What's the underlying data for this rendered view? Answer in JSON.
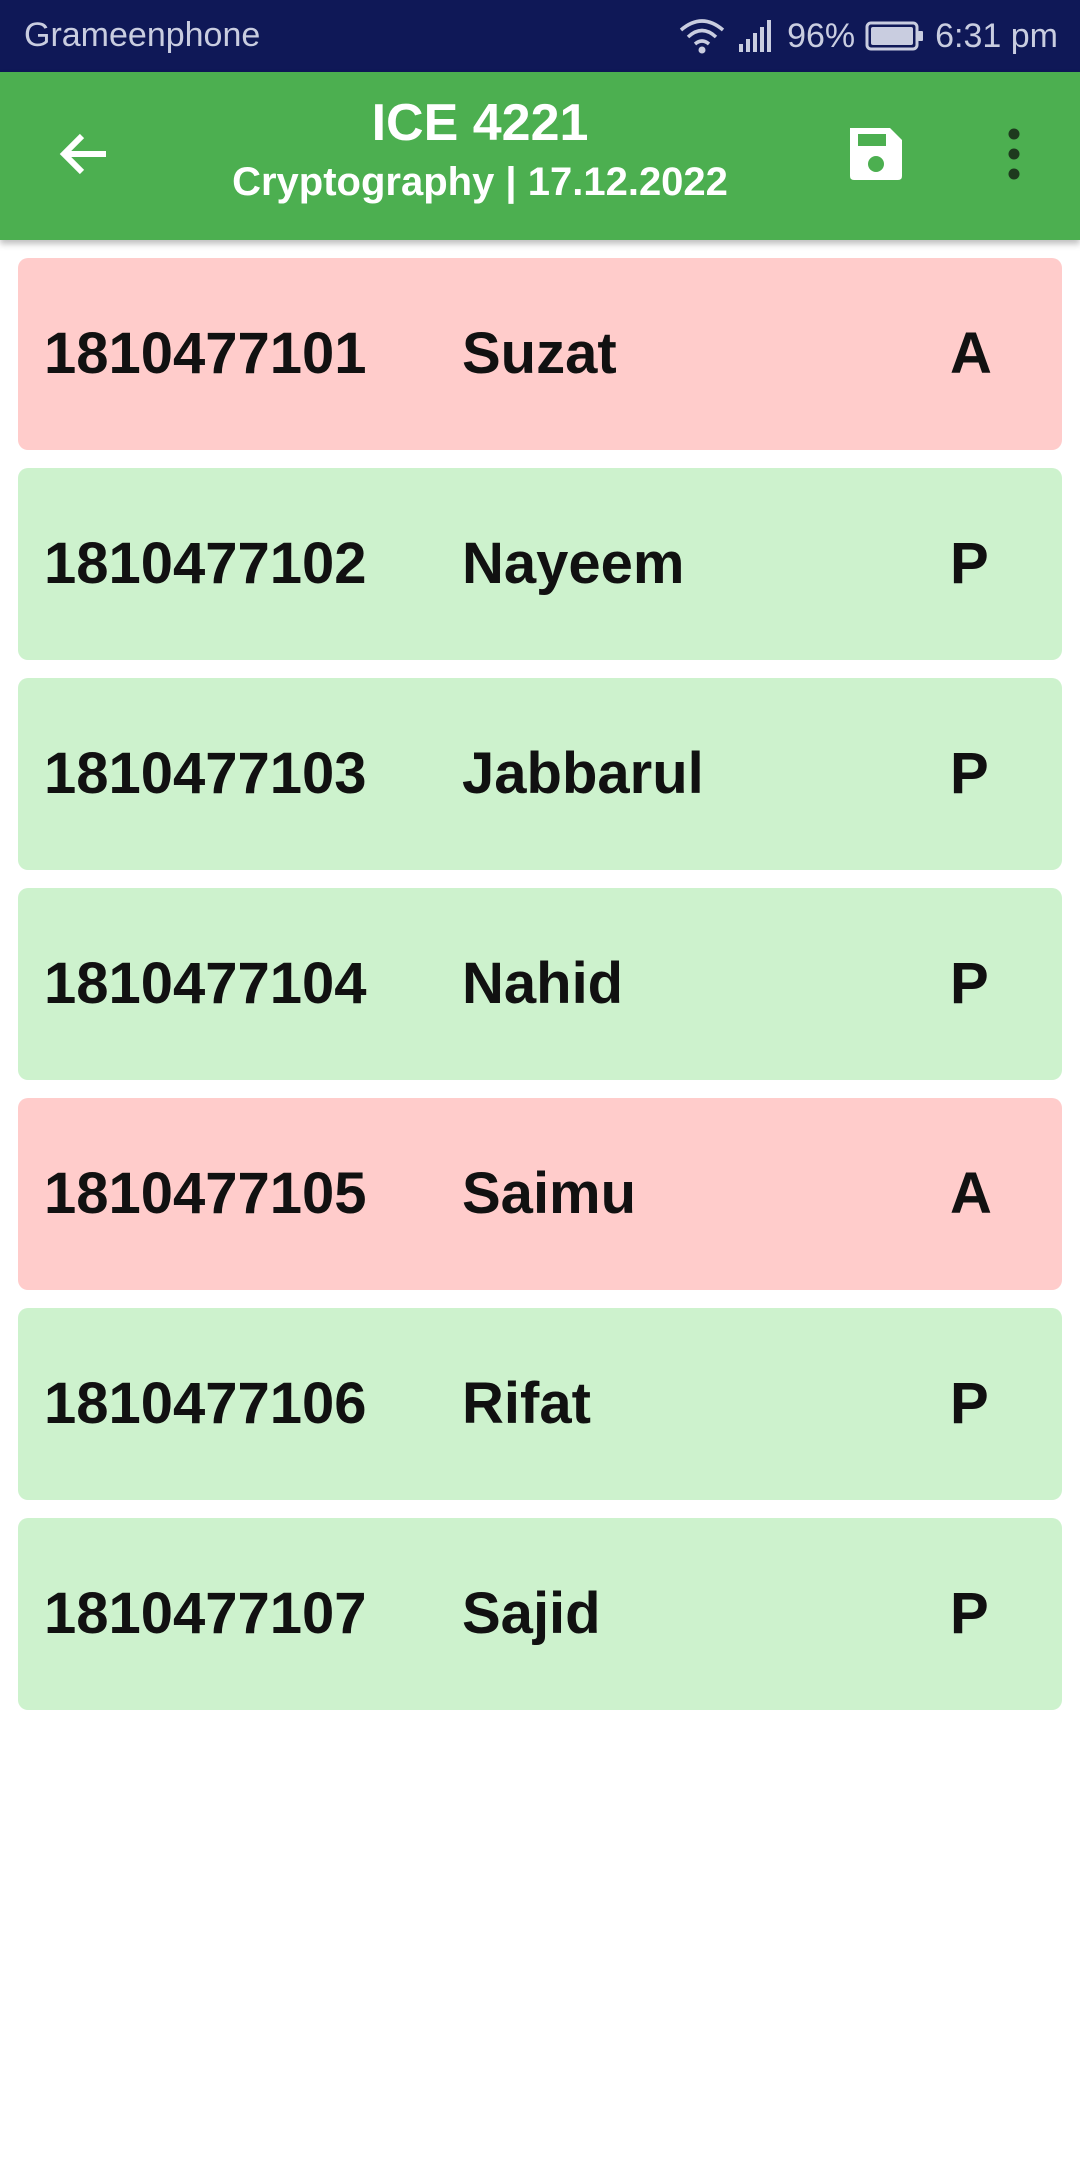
{
  "status_bar": {
    "carrier": "Grameenphone",
    "battery": "96%",
    "time": "6:31 pm",
    "icons": [
      "wifi-icon",
      "signal-icon",
      "battery-icon"
    ]
  },
  "app_bar": {
    "title": "ICE 4221",
    "subtitle": "Cryptography  | 17.12.2022",
    "color": "#4caf50",
    "icons": [
      "back-arrow-icon",
      "save-icon",
      "more-vert-icon"
    ]
  },
  "colors": {
    "absent": "#ffcccb",
    "present": "#cdf2cd",
    "status_bar": "#0f1857"
  },
  "students": [
    {
      "roll": "1810477101",
      "name": "Suzat",
      "mark": "A",
      "status": "absent"
    },
    {
      "roll": "1810477102",
      "name": "Nayeem",
      "mark": "P",
      "status": "present"
    },
    {
      "roll": "1810477103",
      "name": "Jabbarul",
      "mark": "P",
      "status": "present"
    },
    {
      "roll": "1810477104",
      "name": "Nahid",
      "mark": "P",
      "status": "present"
    },
    {
      "roll": "1810477105",
      "name": "Saimu",
      "mark": "A",
      "status": "absent"
    },
    {
      "roll": "1810477106",
      "name": "Rifat",
      "mark": "P",
      "status": "present"
    },
    {
      "roll": "1810477107",
      "name": "Sajid",
      "mark": "P",
      "status": "present"
    }
  ]
}
